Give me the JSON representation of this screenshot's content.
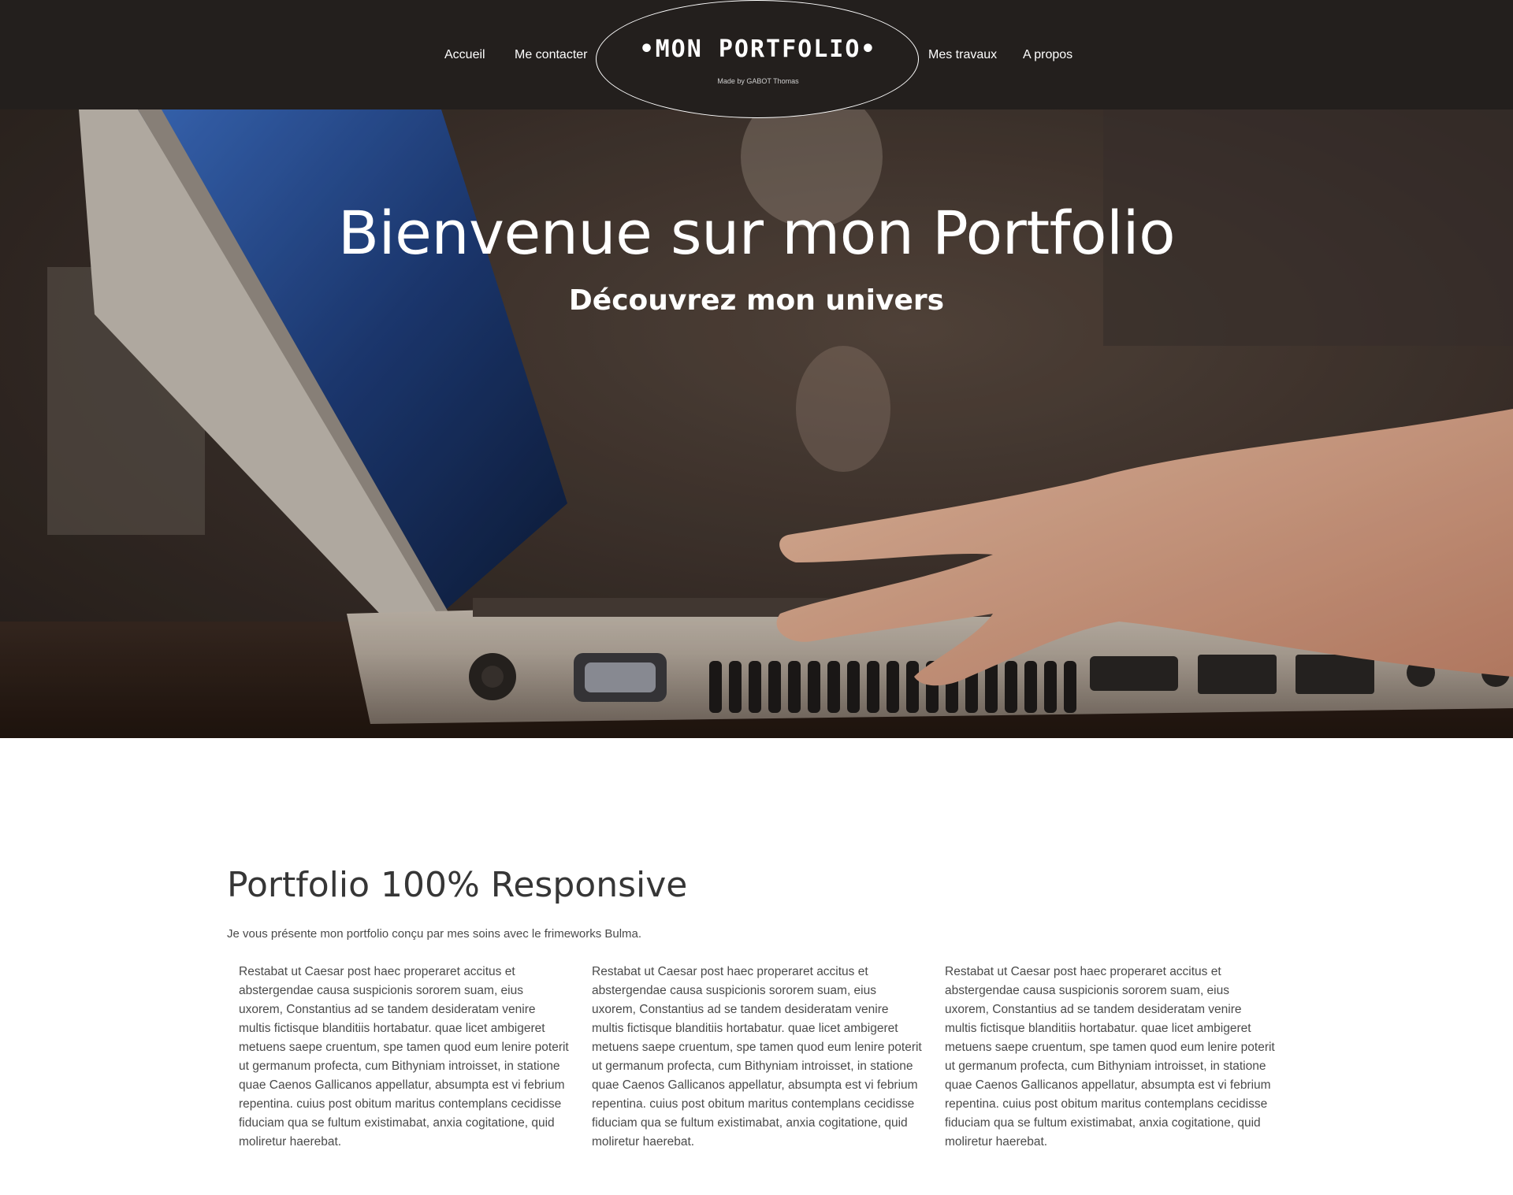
{
  "nav": {
    "links": [
      "Accueil",
      "Me contacter",
      "Mes travaux",
      "A propos"
    ],
    "logo_title": "•MON PORTFOLIO•",
    "logo_subtitle": "Made by GABOT Thomas"
  },
  "hero": {
    "title": "Bienvenue sur mon Portfolio",
    "subtitle": "Découvrez mon univers"
  },
  "section": {
    "title": "Portfolio 100% Responsive",
    "intro": "Je vous présente mon portfolio conçu par mes soins avec le frimeworks Bulma.",
    "columns": [
      "Restabat ut Caesar post haec properaret accitus et abstergendae causa suspicionis sororem suam, eius uxorem, Constantius ad se tandem desideratam venire multis fictisque blanditiis hortabatur. quae licet ambigeret metuens saepe cruentum, spe tamen quod eum lenire poterit ut germanum profecta, cum Bithyniam introisset, in statione quae Caenos Gallicanos appellatur, absumpta est vi febrium repentina. cuius post obitum maritus contemplans cecidisse fiduciam qua se fultum existimabat, anxia cogitatione, quid moliretur haerebat.",
      "Restabat ut Caesar post haec properaret accitus et abstergendae causa suspicionis sororem suam, eius uxorem, Constantius ad se tandem desideratam venire multis fictisque blanditiis hortabatur. quae licet ambigeret metuens saepe cruentum, spe tamen quod eum lenire poterit ut germanum profecta, cum Bithyniam introisset, in statione quae Caenos Gallicanos appellatur, absumpta est vi febrium repentina. cuius post obitum maritus contemplans cecidisse fiduciam qua se fultum existimabat, anxia cogitatione, quid moliretur haerebat.",
      "Restabat ut Caesar post haec properaret accitus et abstergendae causa suspicionis sororem suam, eius uxorem, Constantius ad se tandem desideratam venire multis fictisque blanditiis hortabatur. quae licet ambigeret metuens saepe cruentum, spe tamen quod eum lenire poterit ut germanum profecta, cum Bithyniam introisset, in statione quae Caenos Gallicanos appellatur, absumpta est vi febrium repentina. cuius post obitum maritus contemplans cecidisse fiduciam qua se fultum existimabat, anxia cogitatione, quid moliretur haerebat."
    ]
  },
  "colors": {
    "navbar_bg": "#231f1d",
    "text_dark": "#363636",
    "text_body": "#4a4a4a"
  }
}
